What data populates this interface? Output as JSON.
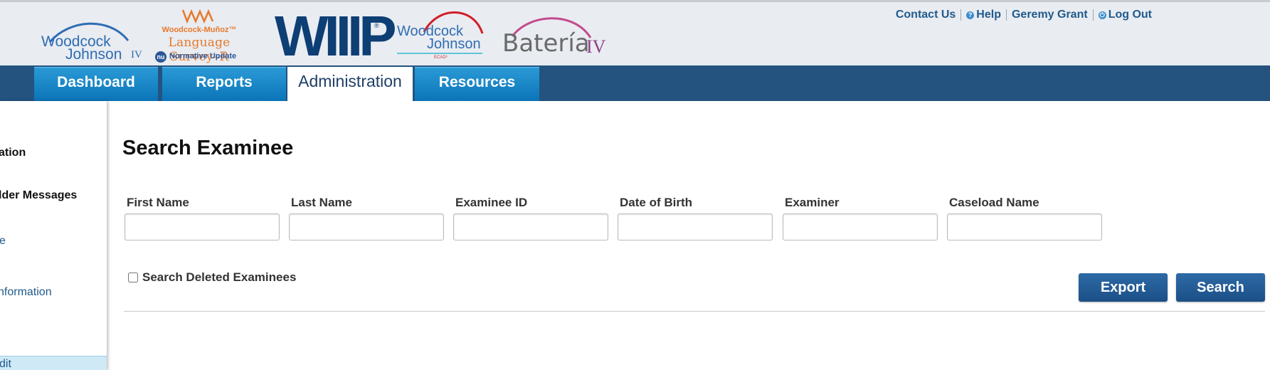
{
  "header": {
    "logos": {
      "wj_line1": "Woodcock",
      "wj_line2": "Johnson",
      "wj_iv": "IV",
      "wm_line1": "Woodcock-Muñoz™",
      "wm_line2": "Language Survey–R",
      "wm_nu": "nu",
      "wm_line3": "Normative Update",
      "wiiip": "WIIIP",
      "wiiip_reg": "®",
      "wjecad_line1": "Woodcock",
      "wjecad_line2": "Johnson",
      "wjecad_sub": "ECAD³",
      "bateria": "Batería",
      "bateria_iv": "IV"
    },
    "links": {
      "contact": "Contact Us",
      "help_icon": "?",
      "help": "Help",
      "user": "Geremy Grant",
      "logout_icon": "⏻",
      "logout": "Log Out"
    }
  },
  "nav": {
    "tabs": [
      {
        "label": "Dashboard"
      },
      {
        "label": "Reports"
      },
      {
        "label": "Administration"
      },
      {
        "label": "Resources"
      }
    ],
    "active": "Administration"
  },
  "sidebar": {
    "items": [
      {
        "label": "ation"
      },
      {
        "label": "lder Messages"
      },
      {
        "label": "e"
      },
      {
        "label": "nformation"
      },
      {
        "label": "dit"
      }
    ]
  },
  "main": {
    "title": "Search Examinee",
    "fields": [
      {
        "label": "First Name",
        "value": ""
      },
      {
        "label": "Last Name",
        "value": ""
      },
      {
        "label": "Examinee ID",
        "value": ""
      },
      {
        "label": "Date of Birth",
        "value": ""
      },
      {
        "label": "Examiner",
        "value": ""
      },
      {
        "label": "Caseload Name",
        "value": ""
      }
    ],
    "deleted_checkbox_label": "Search Deleted Examinees",
    "deleted_checked": false,
    "export_label": "Export",
    "search_label": "Search"
  },
  "colors": {
    "nav_bar": "#24537f",
    "tab_gradient_top": "#2a9ad6",
    "button": "#1c4f86",
    "header_bg": "#e9ecf1",
    "link": "#1f5a8c"
  }
}
